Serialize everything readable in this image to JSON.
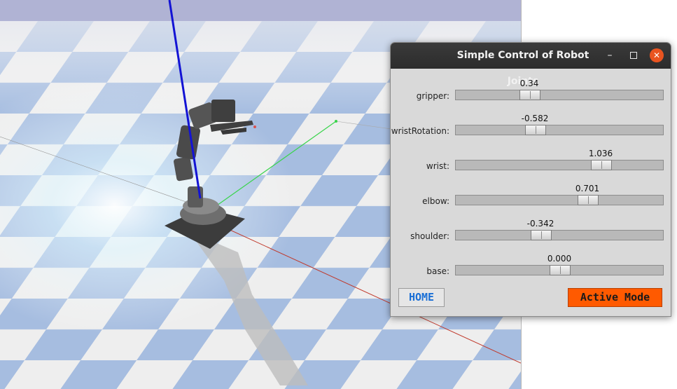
{
  "window": {
    "title": "Simple Control of Robot Joints",
    "minimize_glyph": "–",
    "close_glyph": "✕"
  },
  "joints": [
    {
      "label": "gripper:",
      "value": "0.34",
      "position": 0.34
    },
    {
      "label": "wristRotation:",
      "value": "-0.582",
      "position": 0.37
    },
    {
      "label": "wrist:",
      "value": "1.036",
      "position": 0.72
    },
    {
      "label": "elbow:",
      "value": "0.701",
      "position": 0.65
    },
    {
      "label": "shoulder:",
      "value": "-0.342",
      "position": 0.4
    },
    {
      "label": "base:",
      "value": "0.000",
      "position": 0.5
    }
  ],
  "buttons": {
    "home": "HOME",
    "mode": "Active Mode"
  },
  "colors": {
    "sky": "#b0b3d4",
    "floor_blue": "#a6bde0",
    "floor_white": "#eeeeee",
    "accent_orange": "#ff5a00",
    "close_orange": "#e95420"
  }
}
